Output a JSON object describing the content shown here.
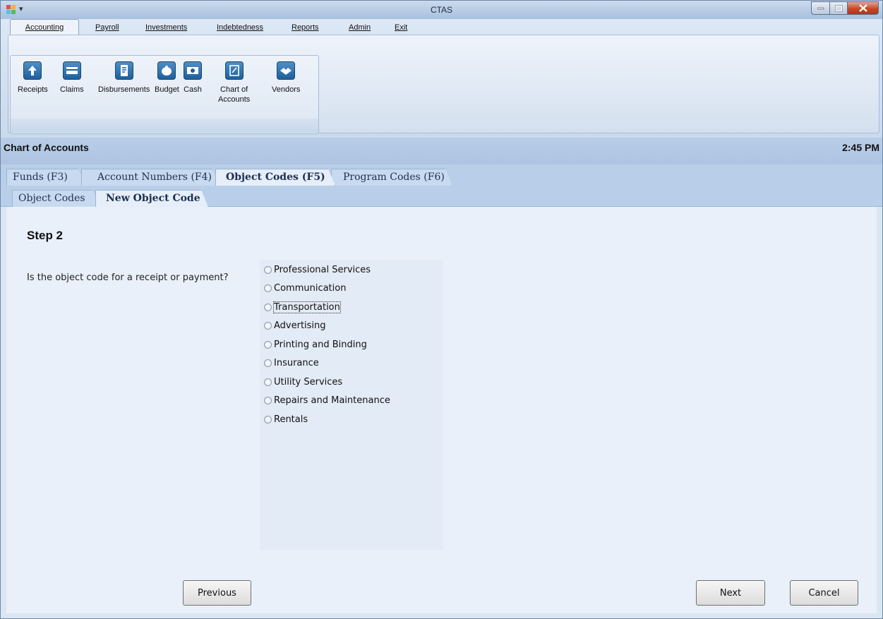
{
  "window": {
    "title": "CTAS"
  },
  "menu": {
    "tabs": [
      {
        "label": "Accounting"
      },
      {
        "label": "Payroll"
      },
      {
        "label": "Investments"
      },
      {
        "label": "Indebtedness"
      },
      {
        "label": "Reports"
      },
      {
        "label": "Admin"
      },
      {
        "label": "Exit"
      }
    ]
  },
  "ribbon": {
    "buttons": [
      {
        "label": "Receipts",
        "icon": "receipts-icon"
      },
      {
        "label": "Claims",
        "icon": "claims-icon"
      },
      {
        "label": "Disbursements",
        "icon": "disbursements-icon"
      },
      {
        "label": "Budget",
        "icon": "budget-icon"
      },
      {
        "label": "Cash",
        "icon": "cash-icon"
      },
      {
        "label": "Chart of\nAccounts",
        "icon": "chart-of-accounts-icon"
      },
      {
        "label": "Vendors",
        "icon": "vendors-icon"
      }
    ]
  },
  "header": {
    "title": "Chart of Accounts",
    "time": "2:45 PM"
  },
  "tabs_primary": [
    {
      "label": "Funds (F3)",
      "active": false
    },
    {
      "label": "Account Numbers (F4)",
      "active": false
    },
    {
      "label": "Object Codes (F5)",
      "active": true
    },
    {
      "label": "Program Codes (F6)",
      "active": false
    }
  ],
  "tabs_secondary": [
    {
      "label": "Object Codes",
      "active": false
    },
    {
      "label": "New Object Code",
      "active": true
    }
  ],
  "wizard": {
    "step_title": "Step 2",
    "question": "Is the object code for a receipt or payment?",
    "options": [
      "Professional Services",
      "Communication",
      "Transportation",
      "Advertising",
      "Printing and Binding",
      "Insurance",
      "Utility Services",
      "Repairs and Maintenance",
      "Rentals"
    ],
    "focused_option": "Transportation",
    "selected_option": null
  },
  "buttons": {
    "previous": "Previous",
    "next": "Next",
    "cancel": "Cancel"
  },
  "colors": {
    "accent": "#1d5f9c",
    "close_button": "#c8452e"
  }
}
